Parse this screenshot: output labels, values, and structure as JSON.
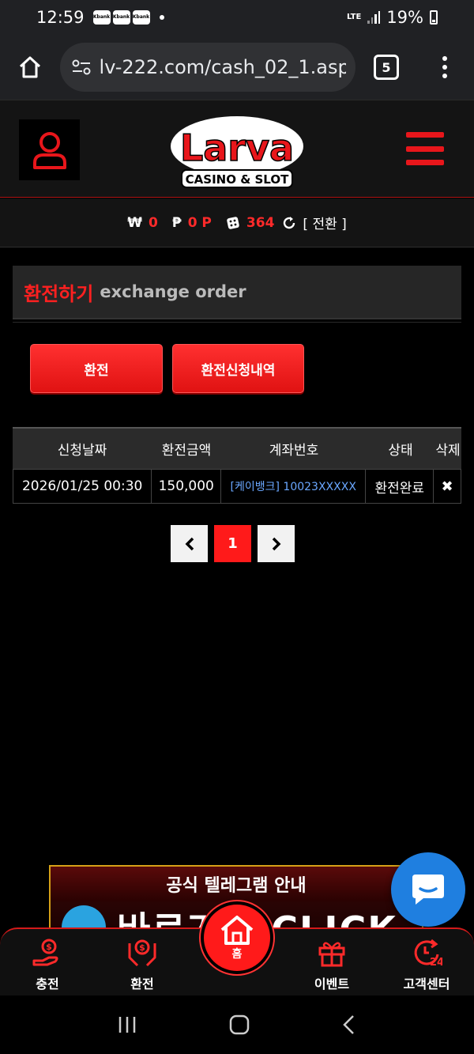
{
  "status_bar": {
    "time": "12:59",
    "notification_badges": [
      "Kbank",
      "Kbank",
      "Kbank"
    ],
    "network": "LTE",
    "battery": "19%"
  },
  "browser": {
    "url": "lv-222.com/cash_02_1.asp",
    "tab_count": "5"
  },
  "header": {
    "logo_main": "Larva",
    "logo_sub": "CASINO & SLOT"
  },
  "balance": {
    "won_symbol": "₩",
    "won_value": "0",
    "point_symbol": "₱",
    "point_value": "0 P",
    "chip_value": "364",
    "swap_label": "[ 전환 ]"
  },
  "page_title": {
    "korean": "환전하기",
    "english": "exchange order"
  },
  "actions": {
    "exchange_label": "환전",
    "history_label": "환전신청내역"
  },
  "table": {
    "headers": [
      "신청날짜",
      "환전금액",
      "계좌번호",
      "상태",
      "삭제"
    ],
    "rows": [
      {
        "date": "2026/01/25 00:30",
        "amount": "150,000",
        "account": "[케이뱅크] 10023XXXXX",
        "status": "환전완료",
        "delete": "✖"
      }
    ]
  },
  "pagination": {
    "prev": "‹",
    "current": "1",
    "next": "›"
  },
  "banner": {
    "title": "공식 텔레그램 안내",
    "cta": "바로가기 CLICK"
  },
  "bottom_nav": {
    "deposit": "충전",
    "withdraw": "환전",
    "home": "홈",
    "event": "이벤트",
    "support": "고객센터"
  },
  "colors": {
    "accent_red": "#ff1a1a",
    "link_blue": "#6aa7ff",
    "chat_blue": "#1f7fe0"
  }
}
